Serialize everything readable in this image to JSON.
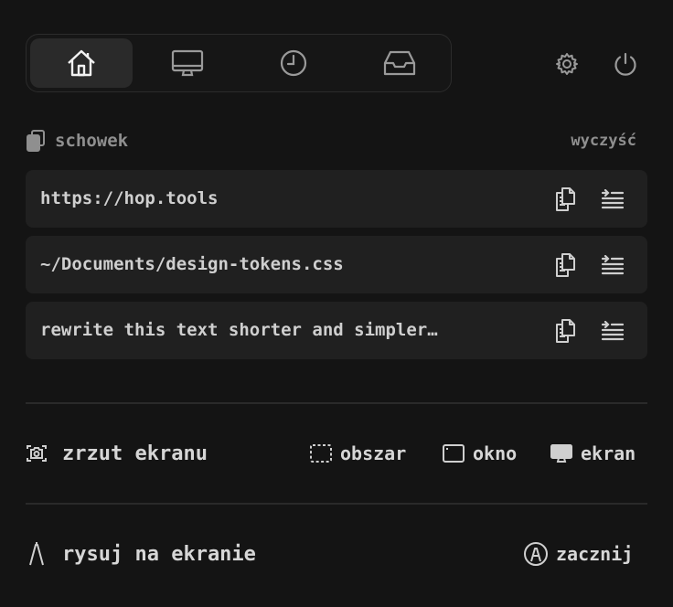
{
  "tabs": [
    {
      "icon": "home-icon",
      "active": true
    },
    {
      "icon": "monitor-icon",
      "active": false
    },
    {
      "icon": "clock-icon",
      "active": false
    },
    {
      "icon": "inbox-icon",
      "active": false
    }
  ],
  "top_actions": {
    "settings_icon": "gear-icon",
    "power_icon": "power-icon"
  },
  "clipboard": {
    "title": "schowek",
    "clear_label": "wyczyść",
    "items": [
      {
        "text": "https://hop.tools"
      },
      {
        "text": "~/Documents/design-tokens.css"
      },
      {
        "text": "rewrite this text shorter and simpler…"
      }
    ]
  },
  "screenshot": {
    "label": "zrzut ekranu",
    "options": [
      {
        "label": "obszar",
        "icon": "region-select-icon"
      },
      {
        "label": "okno",
        "icon": "window-icon"
      },
      {
        "label": "ekran",
        "icon": "display-icon"
      }
    ]
  },
  "draw": {
    "label": "rysuj na ekranie",
    "start_label": "zacznij"
  },
  "colors": {
    "background": "#141414",
    "row": "#202020",
    "active_tab": "#2a2a2a",
    "text": "#cfcfcf",
    "muted": "#8f8f8f"
  }
}
